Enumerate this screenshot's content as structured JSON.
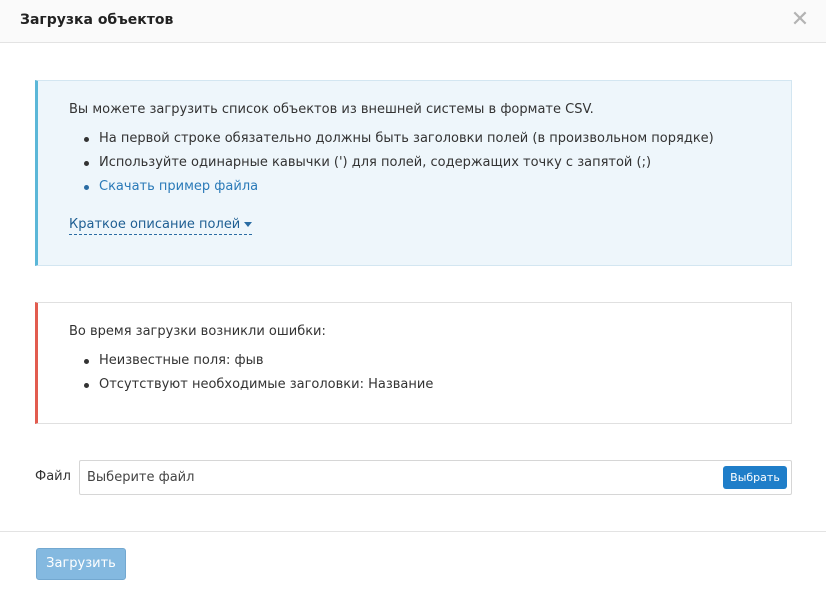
{
  "modal": {
    "title": "Загрузка объектов",
    "close_icon": "close-icon"
  },
  "info": {
    "intro": "Вы можете загрузить список объектов из внешней системы в формате CSV.",
    "bullets": [
      "На первой строке обязательно должны быть заголовки полей (в произвольном порядке)",
      "Используйте одинарные кавычки (') для полей, содержащих точку с запятой (;)"
    ],
    "download_link": "Скачать пример файла",
    "fields_toggle": "Краткое описание полей",
    "accent_color": "#5bb7d8"
  },
  "error": {
    "intro": "Во время загрузки возникли ошибки:",
    "bullets": [
      "Неизвестные поля: фыв",
      "Отсутствуют необходимые заголовки: Название"
    ],
    "accent_color": "#e25c4f"
  },
  "file": {
    "label": "Файл",
    "placeholder": "Выберите файл",
    "choose_button": "Выбрать"
  },
  "footer": {
    "submit_button": "Загрузить"
  }
}
